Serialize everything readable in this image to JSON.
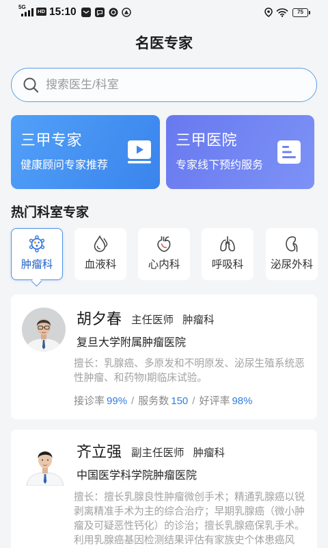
{
  "status_bar": {
    "network": "5G",
    "hd_badge": "HD",
    "time": "15:10",
    "battery": "75",
    "icons": [
      "signal-icon",
      "message-icon",
      "chat-message-icon",
      "app-notification-icon",
      "alert-notification-icon",
      "location-icon",
      "wifi-icon",
      "battery-icon"
    ]
  },
  "header": {
    "title": "名医专家"
  },
  "search": {
    "placeholder": "搜索医生/科室",
    "icon": "search-icon"
  },
  "promo_cards": [
    {
      "title": "三甲专家",
      "subtitle": "健康顾问专家推荐",
      "icon": "video-play-icon"
    },
    {
      "title": "三甲医院",
      "subtitle": "专家线下预约服务",
      "icon": "document-list-icon"
    }
  ],
  "departments_section": {
    "title": "热门科室专家"
  },
  "departments": [
    {
      "label": "肿瘤科",
      "icon": "tumor-cell-icon",
      "selected": true
    },
    {
      "label": "血液科",
      "icon": "blood-drop-icon",
      "selected": false
    },
    {
      "label": "心内科",
      "icon": "heart-icon",
      "selected": false
    },
    {
      "label": "呼吸科",
      "icon": "lungs-icon",
      "selected": false
    },
    {
      "label": "泌尿外科",
      "icon": "kidney-icon",
      "selected": false
    }
  ],
  "doctors": [
    {
      "name": "胡夕春",
      "title": "主任医师",
      "department": "肿瘤科",
      "hospital": "复旦大学附属肿瘤医院",
      "specialty_lines": [
        "擅长：乳腺癌、多原发和不明原发、泌尿生殖系统恶",
        "性肿瘤、和药物I期临床试验。"
      ],
      "stats": [
        {
          "label": "接诊率",
          "value": "99%"
        },
        {
          "label": "服务数",
          "value": "150"
        },
        {
          "label": "好评率",
          "value": "98%"
        }
      ],
      "stat_separator": "/"
    },
    {
      "name": "齐立强",
      "title": "副主任医师",
      "department": "肿瘤科",
      "hospital": "中国医学科学院肿瘤医院",
      "specialty_lines": [
        "擅长：擅长乳腺良性肿瘤微创手术；精通乳腺癌以锐",
        "剥离精准手术为主的综合治疗；早期乳腺癌（微小肿",
        "瘤及可疑恶性钙化）的诊治；擅长乳腺癌保乳手术。",
        "利用乳腺癌基因检测结果评估有家族史个体患癌风"
      ]
    }
  ],
  "colors": {
    "page_bg": "#f4f5f7",
    "accent": "#4a8fe6",
    "search_border": "#5d9ee8",
    "promo_left_from": "#51a0f8",
    "promo_left_to": "#3a84ec",
    "promo_right_from": "#6879ef",
    "promo_right_to": "#7d92f6",
    "stat_value": "#2f7de0",
    "text_muted": "#a2a2a2",
    "selected_label": "#2463c8"
  }
}
